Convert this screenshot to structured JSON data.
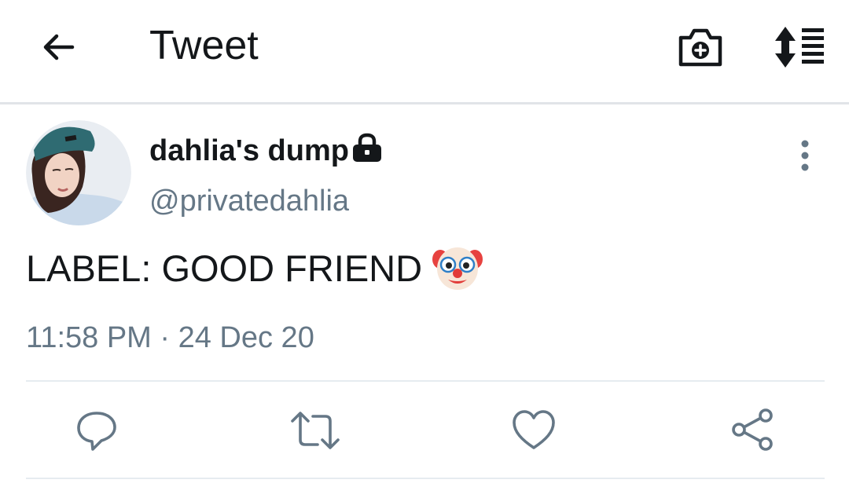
{
  "header": {
    "title": "Tweet",
    "back_icon": "arrow-left-icon",
    "camera_icon": "camera-plus-icon",
    "sort_icon": "sort-list-icon"
  },
  "tweet": {
    "display_name": "dahlia's dump",
    "protected_icon": "lock-icon",
    "handle": "@privatedahlia",
    "text": "LABEL: GOOD FRIEND",
    "text_emoji": "clown-face",
    "timestamp": "11:58 PM · 24 Dec 20",
    "more_icon": "more-vertical-icon"
  },
  "actions": [
    {
      "name": "reply",
      "icon": "reply-bubble-icon"
    },
    {
      "name": "retweet",
      "icon": "retweet-icon"
    },
    {
      "name": "like",
      "icon": "heart-icon"
    },
    {
      "name": "share",
      "icon": "share-icon"
    }
  ],
  "colors": {
    "text_primary": "#14171a",
    "text_secondary": "#657786",
    "icon_action": "#657786",
    "divider": "#e1e4e8"
  }
}
